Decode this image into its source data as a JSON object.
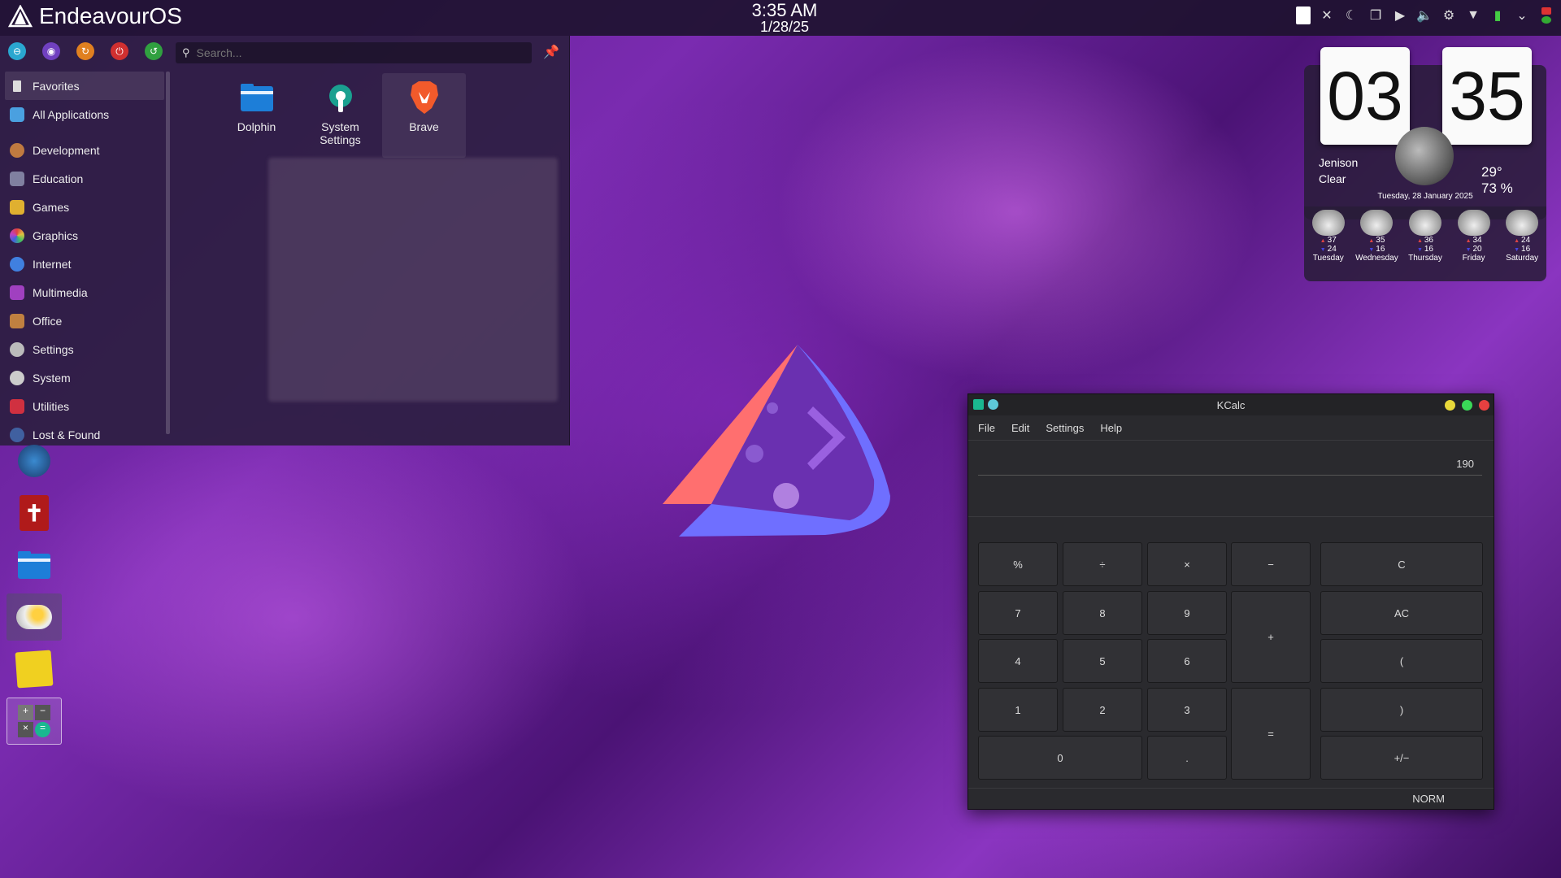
{
  "top_panel": {
    "brand": "EndeavourOS",
    "time": "3:35 AM",
    "date": "1/28/25"
  },
  "launcher": {
    "search_placeholder": "Search...",
    "categories": [
      {
        "label": "Favorites",
        "color": "#dddddd"
      },
      {
        "label": "All Applications",
        "color": "#4aa0e0"
      },
      {
        "label": "Development",
        "color": "#c07a40"
      },
      {
        "label": "Education",
        "color": "#8080a0"
      },
      {
        "label": "Games",
        "color": "#e0b030"
      },
      {
        "label": "Graphics",
        "color": "#e05080"
      },
      {
        "label": "Internet",
        "color": "#4080e0"
      },
      {
        "label": "Multimedia",
        "color": "#a040c0"
      },
      {
        "label": "Office",
        "color": "#c08040"
      },
      {
        "label": "Settings",
        "color": "#bbbbbb"
      },
      {
        "label": "System",
        "color": "#cccccc"
      },
      {
        "label": "Utilities",
        "color": "#d03040"
      },
      {
        "label": "Lost & Found",
        "color": "#4060a0"
      }
    ],
    "apps": [
      {
        "label": "Dolphin"
      },
      {
        "label": "System\nSettings"
      },
      {
        "label": "Brave"
      }
    ]
  },
  "weather": {
    "hour": "03",
    "minute": "35",
    "location": "Jenison",
    "condition": "Clear",
    "temp": "29°",
    "humidity": "73 %",
    "date": "Tuesday, 28 January 2025",
    "forecast": [
      {
        "day": "Tuesday",
        "high": "37",
        "low": "24"
      },
      {
        "day": "Wednesday",
        "high": "35",
        "low": "16"
      },
      {
        "day": "Thursday",
        "high": "36",
        "low": "16"
      },
      {
        "day": "Friday",
        "high": "34",
        "low": "20"
      },
      {
        "day": "Saturday",
        "high": "24",
        "low": "16"
      }
    ]
  },
  "kcalc": {
    "title": "KCalc",
    "menu": [
      "File",
      "Edit",
      "Settings",
      "Help"
    ],
    "display": "190",
    "status": "NORM",
    "keys": {
      "percent": "%",
      "divide": "÷",
      "multiply": "×",
      "minus": "−",
      "clear": "C",
      "seven": "7",
      "eight": "8",
      "nine": "9",
      "plus": "+",
      "all_clear": "AC",
      "four": "4",
      "five": "5",
      "six": "6",
      "open_paren": "(",
      "one": "1",
      "two": "2",
      "three": "3",
      "equals": "=",
      "close_paren": ")",
      "zero": "0",
      "decimal": ".",
      "sign": "+/−"
    }
  }
}
